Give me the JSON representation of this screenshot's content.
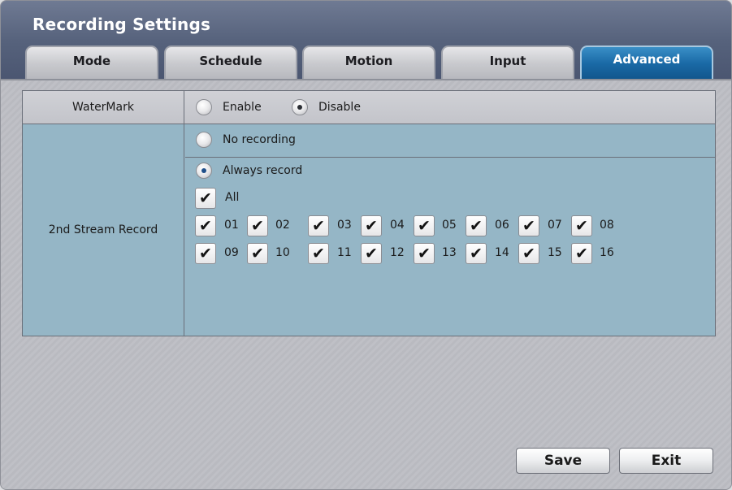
{
  "window": {
    "title": "Recording Settings"
  },
  "tabs": [
    {
      "label": "Mode",
      "active": false
    },
    {
      "label": "Schedule",
      "active": false
    },
    {
      "label": "Motion",
      "active": false
    },
    {
      "label": "Input",
      "active": false
    },
    {
      "label": "Advanced",
      "active": true
    }
  ],
  "watermark": {
    "label": "WaterMark",
    "options": [
      {
        "label": "Enable",
        "selected": false
      },
      {
        "label": "Disable",
        "selected": true
      }
    ]
  },
  "stream_record": {
    "label": "2nd Stream Record",
    "no_recording": {
      "label": "No recording",
      "selected": false
    },
    "always_record": {
      "label": "Always record",
      "selected": true
    },
    "all": {
      "label": "All",
      "checked": true
    },
    "check_mark": "✔",
    "channels": [
      {
        "label": "01",
        "checked": true
      },
      {
        "label": "02",
        "checked": true
      },
      {
        "label": "03",
        "checked": true
      },
      {
        "label": "04",
        "checked": true
      },
      {
        "label": "05",
        "checked": true
      },
      {
        "label": "06",
        "checked": true
      },
      {
        "label": "07",
        "checked": true
      },
      {
        "label": "08",
        "checked": true
      },
      {
        "label": "09",
        "checked": true
      },
      {
        "label": "10",
        "checked": true
      },
      {
        "label": "11",
        "checked": true
      },
      {
        "label": "12",
        "checked": true
      },
      {
        "label": "13",
        "checked": true
      },
      {
        "label": "14",
        "checked": true
      },
      {
        "label": "15",
        "checked": true
      },
      {
        "label": "16",
        "checked": true
      }
    ]
  },
  "buttons": {
    "save": "Save",
    "exit": "Exit"
  },
  "colors": {
    "accent": "#1a6aa6",
    "stream_bg": "#95b6c6",
    "title_bar": "#56627c"
  }
}
